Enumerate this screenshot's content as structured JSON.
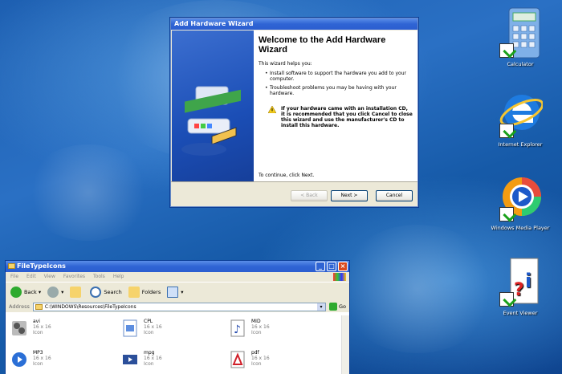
{
  "wizard": {
    "title": "Add Hardware Wizard",
    "heading": "Welcome to the Add Hardware Wizard",
    "intro": "This wizard helps you:",
    "bullets": [
      "Install software to support the hardware you add to your computer.",
      "Troubleshoot problems you may be having with your hardware."
    ],
    "warning": "If your hardware came with an installation CD, it is recommended that you click Cancel to close this wizard and use the manufacturer's CD to install this hardware.",
    "continue": "To continue, click Next.",
    "back_label": "< Back",
    "next_label": "Next >",
    "cancel_label": "Cancel"
  },
  "desktop_icons": [
    {
      "label": "Calculator",
      "icon": "calculator-icon"
    },
    {
      "label": "Internet Explorer",
      "icon": "internet-explorer-icon"
    },
    {
      "label": "Windows Media Player",
      "icon": "media-player-icon"
    },
    {
      "label": "Event Viewer",
      "icon": "event-viewer-icon"
    }
  ],
  "explorer": {
    "title": "FileTypeIcons",
    "menu": [
      "File",
      "Edit",
      "View",
      "Favorites",
      "Tools",
      "Help"
    ],
    "toolbar": {
      "back": "Back",
      "search": "Search",
      "folders": "Folders"
    },
    "address_label": "Address",
    "address_value": "C:\\WINDOWS\\Resources\\FileTypeIcons",
    "go": "Go",
    "files": [
      {
        "name": "avi",
        "size": "16 x 16",
        "type": "Icon",
        "icon": "avi-icon"
      },
      {
        "name": "CPL",
        "size": "16 x 16",
        "type": "Icon",
        "icon": "cpl-icon"
      },
      {
        "name": "MID",
        "size": "16 x 16",
        "type": "Icon",
        "icon": "mid-icon"
      },
      {
        "name": "MP3",
        "size": "16 x 16",
        "type": "Icon",
        "icon": "mp3-icon"
      },
      {
        "name": "mpg",
        "size": "16 x 16",
        "type": "Icon",
        "icon": "mpg-icon"
      },
      {
        "name": "pdf",
        "size": "16 x 16",
        "type": "Icon",
        "icon": "pdf-icon"
      }
    ]
  },
  "colors": {
    "titlebar": "#2f64d4",
    "desktop": "#1d5fb1",
    "wizard_bg": "#ece9d8"
  }
}
